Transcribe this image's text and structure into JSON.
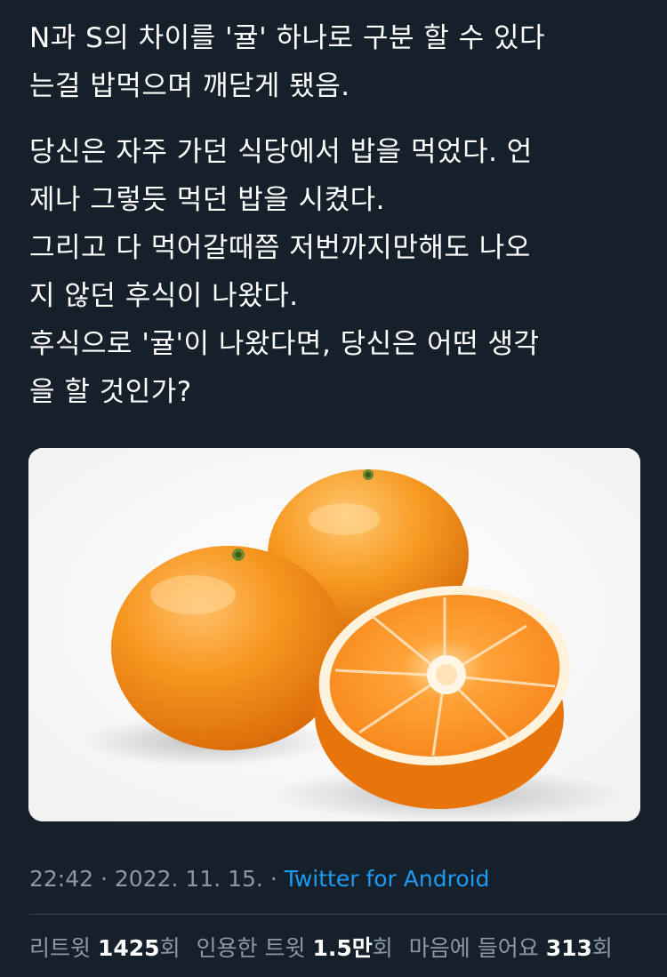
{
  "tweet": {
    "lines": [
      "N과 S의 차이를 '귤' 하나로 구분 할 수 있다",
      "는걸 밥먹으며 깨닫게 됐음.",
      "당신은 자주 가던 식당에서 밥을 먹었다. 언",
      "제나 그렇듯 먹던 밥을 시켰다.",
      "그리고 다 먹어갈때쯤 저번까지만해도 나오",
      "지 않던 후식이 나왔다.",
      "후식으로 '귤'이 나왔다면, 당신은 어떤 생각",
      "을 할 것인가?"
    ]
  },
  "media": {
    "icon": "tangerine-photo",
    "colors": {
      "peel": "#f28a13",
      "flesh": "#ff9a2e",
      "background": "#ffffff"
    }
  },
  "meta": {
    "time": "22:42",
    "separator1": " · ",
    "date": "2022. 11. 15.",
    "separator2": " · ",
    "app": "Twitter for Android"
  },
  "stats": {
    "retweets": {
      "label": "리트윗",
      "value": "1425",
      "suffix": "회"
    },
    "quotes": {
      "label": "인용한 트윗",
      "value": "1.5만",
      "suffix": "회"
    },
    "likes": {
      "label": "마음에 들어요",
      "value": "313",
      "suffix": "회"
    }
  },
  "colors": {
    "background": "#15202b",
    "text": "#ffffff",
    "secondary": "#8b98a5",
    "accent": "#1d9bf0",
    "divider": "#38444d"
  }
}
